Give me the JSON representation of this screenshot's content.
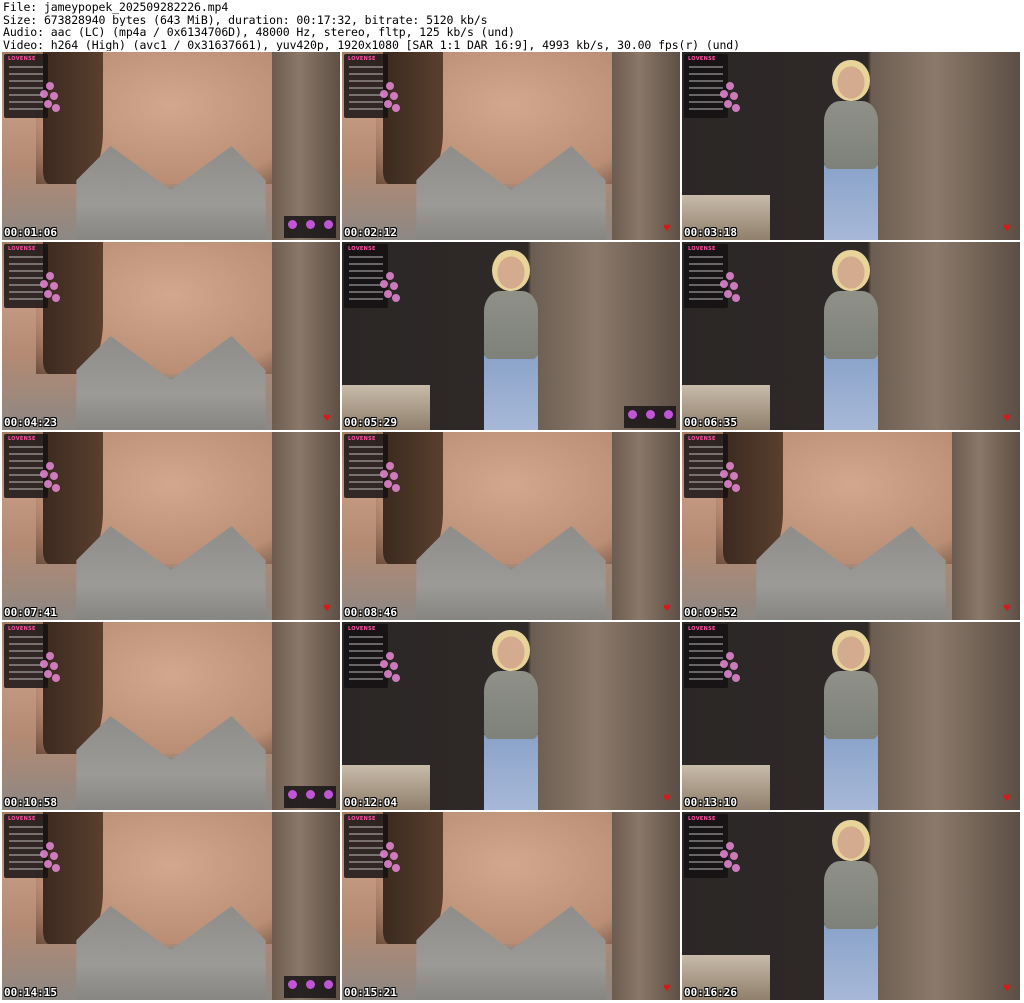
{
  "header": {
    "line1": "File: jameypopek_202509282226.mp4",
    "line2": "Size: 673828940 bytes (643 MiB), duration: 00:17:32, bitrate: 5120 kb/s",
    "line3": "Audio: aac (LC) (mp4a / 0x6134706D), 48000 Hz, stereo, fltp, 125 kb/s (und)",
    "line4": "Video: h264 (High) (avc1 / 0x31637661), yuv420p, 1920x1080 [SAR 1:1 DAR 16:9], 4993 kb/s, 30.00 fps(r) (und)"
  },
  "overlay_brand": "LOVENSE",
  "thumbnails": [
    {
      "time": "00:01:06",
      "scene": "closeup",
      "toys": true
    },
    {
      "time": "00:02:12",
      "scene": "closeup",
      "toys": false
    },
    {
      "time": "00:03:18",
      "scene": "wide",
      "toys": false
    },
    {
      "time": "00:04:23",
      "scene": "closeup",
      "toys": false
    },
    {
      "time": "00:05:29",
      "scene": "wide",
      "toys": true
    },
    {
      "time": "00:06:35",
      "scene": "wide",
      "toys": false
    },
    {
      "time": "00:07:41",
      "scene": "closeup",
      "toys": false
    },
    {
      "time": "00:08:46",
      "scene": "closeup",
      "toys": false
    },
    {
      "time": "00:09:52",
      "scene": "closeup",
      "toys": false
    },
    {
      "time": "00:10:58",
      "scene": "closeup",
      "toys": true
    },
    {
      "time": "00:12:04",
      "scene": "wide",
      "toys": false
    },
    {
      "time": "00:13:10",
      "scene": "wide",
      "toys": false
    },
    {
      "time": "00:14:15",
      "scene": "closeup",
      "toys": true
    },
    {
      "time": "00:15:21",
      "scene": "closeup",
      "toys": false
    },
    {
      "time": "00:16:26",
      "scene": "wide",
      "toys": false
    }
  ],
  "colors": {
    "timestamp_text": "#ffffff",
    "timestamp_outline": "#000000",
    "overlay_brand": "#ff4fa3",
    "heart": "#d41a1a"
  }
}
